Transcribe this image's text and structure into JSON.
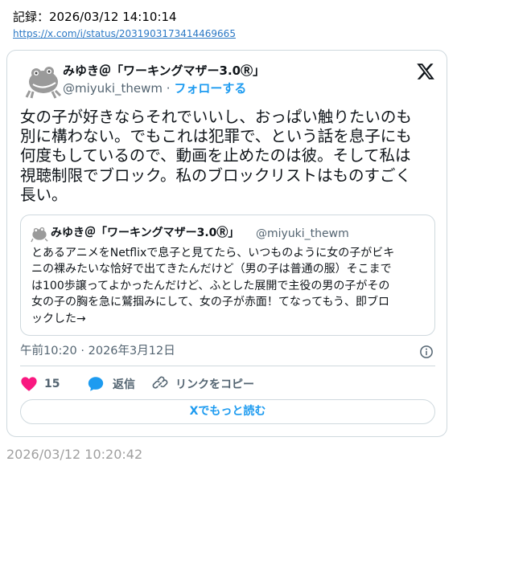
{
  "header": {
    "record_label": "記録：2026/03/12 14:10:14",
    "source_url": "https://x.com/i/status/2031903173414469665"
  },
  "tweet": {
    "author_name": "みゆき＠「ワーキングマザー3.0Ⓡ」",
    "handle": "@miyuki_thewm",
    "separator": " · ",
    "follow_label": "フォローする",
    "text": "女の子が好きならそれでいいし、おっぱい触りたいのも\n別に構わない。でもこれは犯罪で、という話を息子にも\n何度もしているので、動画を止めたのは彼。そして私は\n視聴制限でブロック。私のブロックリストはものすごく\n長い。",
    "quote": {
      "author_name": "みゆき＠「ワーキングマザー3.0Ⓡ」",
      "handle": "@miyuki_thewm",
      "text": "とあるアニメをNetflixで息子と見てたら、いつものように女の子がビキ\nニの裸みたいな恰好で出てきたんだけど（男の子は普通の服）そこまで\nは100歩譲ってよかったんだけど、ふとした展開で主役の男の子がその\n女の子の胸を急に鷲掴みにして、女の子が赤面！てなってもう、即ブロ\nックした→"
    },
    "timestamp": "午前10:20 · 2026年3月12日",
    "like_count": "15",
    "reply_label": "返信",
    "copy_link_label": "リンクをコピー",
    "read_more_label": "Xでもっと読む",
    "colors": {
      "like": "#f91880",
      "reply": "#1d9bf0",
      "link": "#1d9bf0",
      "border": "#cfd9de",
      "muted": "#536471"
    }
  },
  "footer": {
    "captured_time": "2026/03/12 10:20:42"
  },
  "icons": [
    "frog-avatar-icon",
    "x-logo-icon",
    "info-icon",
    "heart-icon",
    "reply-bubble-icon",
    "link-chain-icon"
  ]
}
